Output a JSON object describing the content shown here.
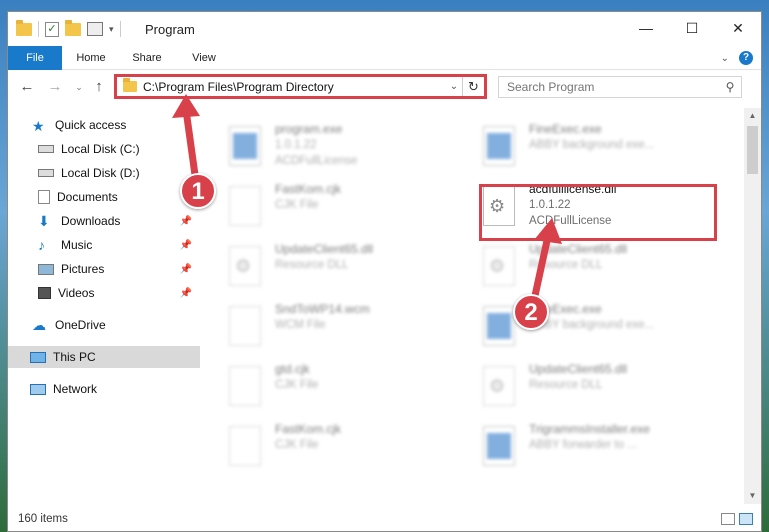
{
  "window": {
    "title": "Program",
    "controls": {
      "minimize": "—",
      "maximize": "☐",
      "close": "✕"
    }
  },
  "ribbon": {
    "tabs": [
      {
        "label": "File"
      },
      {
        "label": "Home"
      },
      {
        "label": "Share"
      },
      {
        "label": "View"
      }
    ]
  },
  "navbar": {
    "address": "C:\\Program Files\\Program Directory",
    "search_placeholder": "Search Program"
  },
  "sidebar": {
    "items": [
      {
        "label": "Quick access",
        "icon": "star-icon",
        "pinned": false
      },
      {
        "label": "Local Disk (C:)",
        "icon": "drive-icon",
        "pinned": false
      },
      {
        "label": "Local Disk (D:)",
        "icon": "drive-icon",
        "pinned": false
      },
      {
        "label": "Documents",
        "icon": "documents-icon",
        "pinned": false
      },
      {
        "label": "Downloads",
        "icon": "downloads-icon",
        "pinned": true
      },
      {
        "label": "Music",
        "icon": "music-icon",
        "pinned": true
      },
      {
        "label": "Pictures",
        "icon": "pictures-icon",
        "pinned": true
      },
      {
        "label": "Videos",
        "icon": "videos-icon",
        "pinned": true
      },
      {
        "label": "OneDrive",
        "icon": "cloud-icon",
        "pinned": false
      },
      {
        "label": "This PC",
        "icon": "computer-icon",
        "pinned": false,
        "selected": true
      },
      {
        "label": "Network",
        "icon": "network-icon",
        "pinned": false
      }
    ]
  },
  "files": {
    "left": [
      {
        "name": "program.exe",
        "line2": "1.0.1.22",
        "line3": "ACDFullLicense",
        "icon": "program-exe-icon"
      },
      {
        "name": "FastKom.cjk",
        "line2": "CJK File",
        "line3": "",
        "icon": "document-icon"
      },
      {
        "name": "UpdateClient65.dll",
        "line2": "Resource DLL",
        "line3": "",
        "icon": "dll-icon"
      },
      {
        "name": "SndToWP14.wcm",
        "line2": "WCM File",
        "line3": "",
        "icon": "document-icon"
      },
      {
        "name": "gtd.cjk",
        "line2": "CJK File",
        "line3": "",
        "icon": "document-icon"
      },
      {
        "name": "FastKom.cjk",
        "line2": "CJK File",
        "line3": "",
        "icon": "document-icon"
      }
    ],
    "right": [
      {
        "name": "FineExec.exe",
        "line2": "ABBY background exe...",
        "line3": "",
        "icon": "exe-icon"
      },
      {
        "name": "acdfulllicense.dll",
        "line2": "1.0.1.22",
        "line3": "ACDFullLicense",
        "icon": "dll-icon",
        "highlighted": true
      },
      {
        "name": "UpdateClient65.dll",
        "line2": "Resource DLL",
        "line3": "",
        "icon": "dll-icon"
      },
      {
        "name": "FineExec.exe",
        "line2": "ABBY background exe...",
        "line3": "",
        "icon": "exe-icon"
      },
      {
        "name": "UpdateClient65.dll",
        "line2": "Resource DLL",
        "line3": "",
        "icon": "dll-icon"
      },
      {
        "name": "TrigrammsInstaller.exe",
        "line2": "ABBY forwarder to ...",
        "line3": "",
        "icon": "exe-icon"
      }
    ]
  },
  "status": {
    "item_count": "160 items"
  },
  "callouts": {
    "first": "1",
    "second": "2"
  },
  "colors": {
    "accent": "#1979ca",
    "highlight": "#d8404a"
  }
}
